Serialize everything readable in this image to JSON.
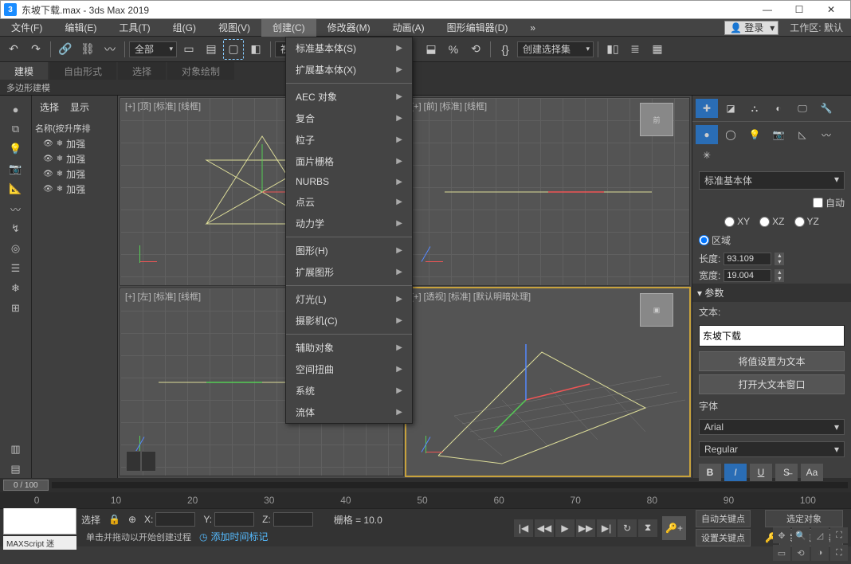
{
  "title": "东坡下载.max - 3ds Max 2019",
  "menus": [
    "文件(F)",
    "编辑(E)",
    "工具(T)",
    "组(G)",
    "视图(V)",
    "创建(C)",
    "修改器(M)",
    "动画(A)",
    "图形编辑器(D)"
  ],
  "active_menu_index": 5,
  "login": "登录",
  "workspace_label": "工作区:",
  "workspace_value": "默认",
  "toolbar_select_all": "全部",
  "toolbar_view": "视图",
  "toolbar_createset": "创建选择集",
  "ribbon_tabs": [
    "建模",
    "自由形式",
    "选择",
    "对象绘制"
  ],
  "ribbon_sub": "多边形建模",
  "scene_tabs": [
    "选择",
    "显示"
  ],
  "scene_header": "名称(按升序排",
  "scene_items": [
    "加强",
    "加强",
    "加强",
    "加强"
  ],
  "viewports": {
    "tl": "[+] [顶] [标准] [线框]",
    "tr": "[+] [前] [标准] [线框]",
    "bl": "[+] [左] [标准] [线框]",
    "br": "[+] [透视] [标准] [默认明暗处理]"
  },
  "dropdown": {
    "groups": [
      [
        "标准基本体(S)",
        "扩展基本体(X)"
      ],
      [
        "AEC 对象",
        "复合",
        "粒子",
        "面片栅格",
        "NURBS",
        "点云",
        "动力学"
      ],
      [
        "图形(H)",
        "扩展图形"
      ],
      [
        "灯光(L)",
        "摄影机(C)"
      ],
      [
        "辅助对象",
        "空间扭曲",
        "系统",
        "流体"
      ]
    ]
  },
  "cmd": {
    "category": "标准基本体",
    "auto": "自动",
    "axes": [
      "XY",
      "XZ",
      "YZ"
    ],
    "region": "区域",
    "len_label": "长度:",
    "len_val": "93.109",
    "wid_label": "宽度:",
    "wid_val": "19.004",
    "params_title": "参数",
    "text_label": "文本:",
    "text_value": "东坡下载",
    "btn_set": "将值设置为文本",
    "btn_open": "打开大文本窗口",
    "font_label": "字体",
    "font_name": "Arial",
    "font_style": "Regular"
  },
  "time": {
    "pos": "0 / 100",
    "ticks": [
      "0",
      "10",
      "20",
      "30",
      "40",
      "50",
      "60",
      "70",
      "80",
      "90",
      "100"
    ]
  },
  "status": {
    "maxscript": "MAXScript 迷",
    "select_label": "选择",
    "x": "X:",
    "y": "Y:",
    "z": "Z:",
    "grid": "栅格 = 10.0",
    "hint": "单击并拖动以开始创建过程",
    "addtime": "添加时间标记",
    "autokey": "自动关键点",
    "setkey": "设置关键点",
    "selobj": "选定对象",
    "keyfilter": "关键点过滤器"
  }
}
